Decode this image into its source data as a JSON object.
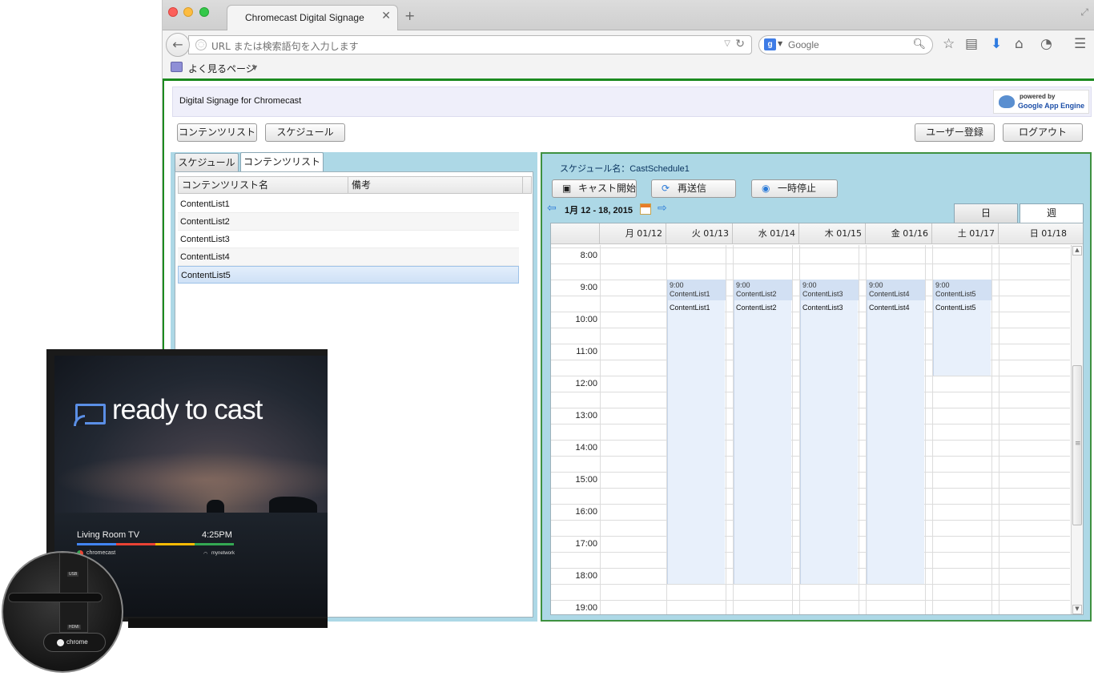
{
  "browser": {
    "tab_title": "Chromecast Digital Signage",
    "url_placeholder": "URL または検索語句を入力します",
    "search_engine_label": "g",
    "search_placeholder": "Google",
    "bookmarks_label": "よく見るページ"
  },
  "app": {
    "title": "Digital Signage for Chromecast",
    "gae_powered": "powered by",
    "gae_name": "Google App Engine",
    "nav": {
      "contents_list": "コンテンツリスト",
      "schedule": "スケジュール",
      "user_register": "ユーザー登録",
      "logout": "ログアウト"
    },
    "left_tabs": [
      "スケジュール",
      "コンテンツリスト"
    ],
    "list": {
      "columns": [
        "コンテンツリスト名",
        "備考"
      ],
      "rows": [
        {
          "name": "ContentList1",
          "note": ""
        },
        {
          "name": "ContentList2",
          "note": ""
        },
        {
          "name": "ContentList3",
          "note": ""
        },
        {
          "name": "ContentList4",
          "note": ""
        },
        {
          "name": "ContentList5",
          "note": ""
        }
      ],
      "selected_index": 4
    },
    "schedule": {
      "name_label": "スケジュール名：CastSchedule1",
      "actions": {
        "start_cast": "キャスト開始",
        "resend": "再送信",
        "pause": "一時停止"
      },
      "date_range": "1月 12 - 18, 2015",
      "view_tabs": [
        "日",
        "週"
      ],
      "active_view": "週",
      "day_headers": [
        "月 01/12",
        "火 01/13",
        "水 01/14",
        "木 01/15",
        "金 01/16",
        "土 01/17",
        "日 01/18"
      ],
      "hours": [
        "8:00",
        "9:00",
        "10:00",
        "11:00",
        "12:00",
        "13:00",
        "14:00",
        "15:00",
        "16:00",
        "17:00",
        "18:00",
        "19:00"
      ],
      "events": [
        {
          "day": "火 01/13",
          "time": "9:00",
          "title": "ContentList1",
          "body": "ContentList1"
        },
        {
          "day": "水 01/14",
          "time": "9:00",
          "title": "ContentList2",
          "body": "ContentList2"
        },
        {
          "day": "木 01/15",
          "time": "9:00",
          "title": "ContentList3",
          "body": "ContentList3"
        },
        {
          "day": "金 01/16",
          "time": "9:00",
          "title": "ContentList4",
          "body": "ContentList4"
        },
        {
          "day": "土 01/17",
          "time": "9:00",
          "title": "ContentList5",
          "body": "ContentList5"
        }
      ]
    }
  },
  "tv": {
    "headline": "ready to cast",
    "device_name": "Living Room TV",
    "time": "4:25PM",
    "brand": "chromecast",
    "network": "mynetwork",
    "usb_label": "USB",
    "hdmi_label": "HDMI",
    "dongle_brand": "chrome"
  },
  "colors": {
    "page_border": "#1b8a1f",
    "panel_bg": "#add8e6",
    "event_bg": "#e8f0fb",
    "event_head": "#d2e0f3",
    "selected_row": "#cfe1f6",
    "cast_blue": "#5b8fe6"
  }
}
